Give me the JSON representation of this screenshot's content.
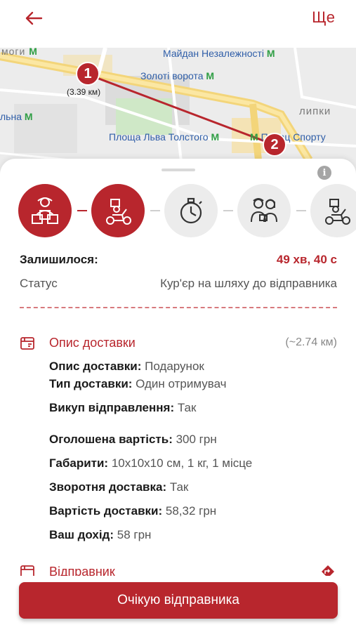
{
  "header": {
    "back_icon": "arrow-left-icon",
    "more_label": "Ще"
  },
  "map": {
    "labels": {
      "mohy": "моги",
      "maidan": "Майдан Незалежності",
      "zoloti": "Золоті ворота",
      "lypky": "липки",
      "lna": "льна",
      "tolstoho": "Площа Льва Толстого",
      "sportu": "Палац Спорту"
    },
    "metro_glyph": "M",
    "distance": "(3.39 км)",
    "marker_start": "1",
    "marker_end": "2",
    "route_color": "#b8262d"
  },
  "sheet": {
    "info_glyph": "i",
    "steps": [
      {
        "name": "courier-packages",
        "state": "done"
      },
      {
        "name": "courier-scooter",
        "state": "current"
      },
      {
        "name": "stopwatch",
        "state": "pending"
      },
      {
        "name": "recipient-handover",
        "state": "pending"
      },
      {
        "name": "courier-scooter-return",
        "state": "pending"
      }
    ],
    "remaining_label": "Залишилося:",
    "remaining_value": "49 хв, 40 с",
    "status_label": "Статус",
    "status_value": "Кур'єр на шляху до відправника"
  },
  "delivery": {
    "title": "Опис доставки",
    "distance": "(~2.74 км)",
    "details": [
      {
        "label": "Опис доставки:",
        "value": " Подарунок"
      },
      {
        "label": "Тип доставки:",
        "value": " Один отримувач"
      },
      {
        "label": "Викуп відправлення:",
        "value": " Так"
      },
      {
        "label": "Оголошена вартість:",
        "value": " 300 грн"
      },
      {
        "label": "Габарити:",
        "value": " 10х10х10 см, 1 кг, 1 місце"
      },
      {
        "label": "Зворотня доставка:",
        "value": " Так"
      },
      {
        "label": "Вартість доставки:",
        "value": " 58,32 грн"
      },
      {
        "label": "Ваш дохід:",
        "value": " 58 грн"
      }
    ]
  },
  "sender": {
    "title": "Відправник"
  },
  "action": {
    "button_label": "Очікую відправника"
  },
  "colors": {
    "accent": "#b8262d",
    "inactive": "#ececec"
  }
}
